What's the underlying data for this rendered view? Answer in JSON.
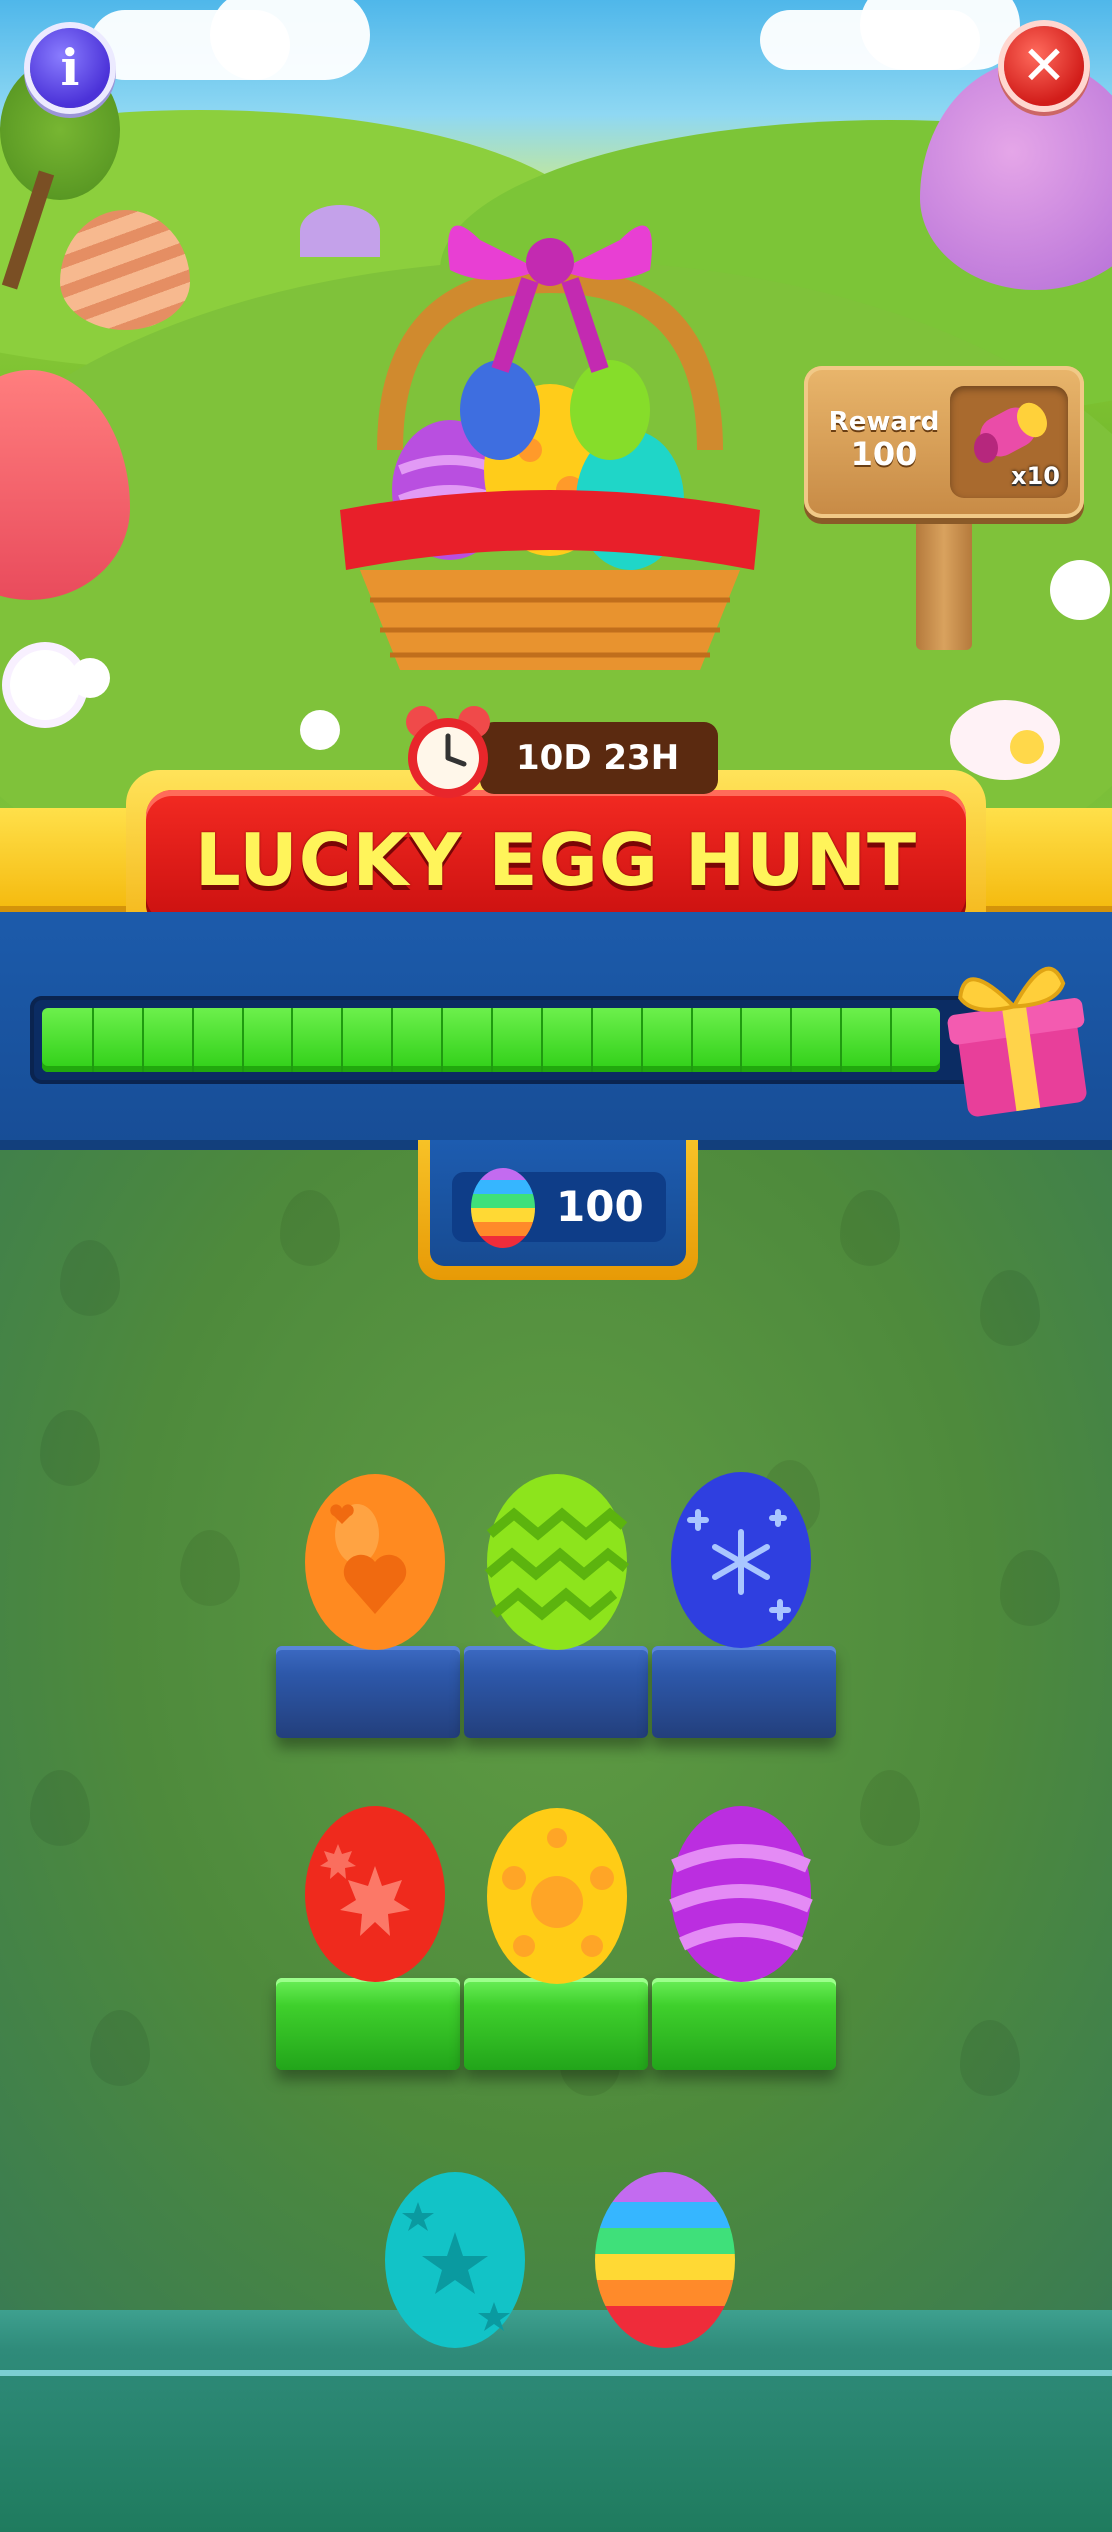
{
  "event": {
    "title": "LUCKY EGG HUNT",
    "timer": "10D 23H"
  },
  "reward": {
    "label_line1": "Reward",
    "label_line2": "100",
    "item_icon": "pink-cannon-icon",
    "item_multiplier": "x10"
  },
  "progress": {
    "fraction": 0.97,
    "segments": 18,
    "end_icon": "gift-box-icon"
  },
  "counter": {
    "icon": "rainbow-egg-icon",
    "value": "100"
  },
  "buttons": {
    "info_icon": "info-icon",
    "info_glyph": "i",
    "close_icon": "close-icon",
    "close_glyph": "✕"
  },
  "shelves": [
    {
      "color": "blue",
      "eggs": [
        "orange-heart-egg",
        "green-zigzag-egg",
        "blue-snowflake-egg"
      ]
    },
    {
      "color": "green",
      "eggs": [
        "red-maple-egg",
        "yellow-dots-egg",
        "purple-stripes-egg"
      ]
    }
  ],
  "tray": {
    "eggs": [
      "teal-star-egg",
      "rainbow-striped-egg"
    ]
  },
  "colors": {
    "banner_red": "#e11a16",
    "banner_gold": "#f5c21a",
    "title_text": "#fff45a",
    "progress_green": "#4fe334",
    "panel_blue": "#1c5bab"
  }
}
